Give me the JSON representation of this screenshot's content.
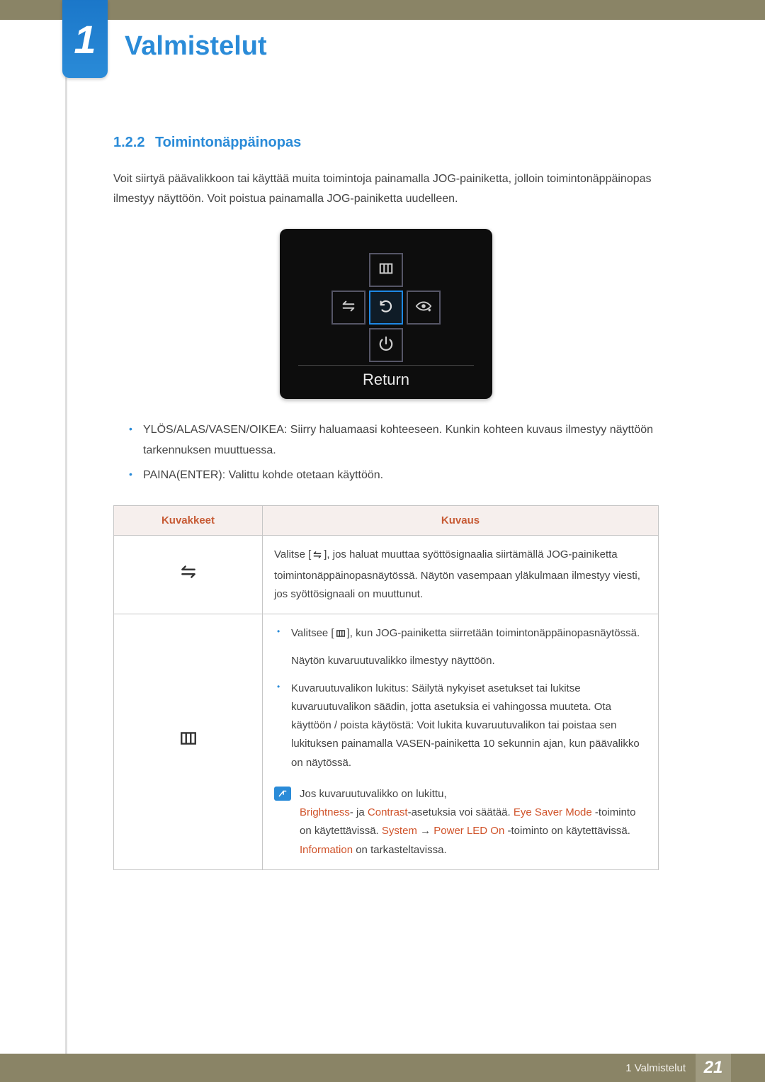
{
  "chapter": {
    "number": "1",
    "title": "Valmistelut"
  },
  "section": {
    "number": "1.2.2",
    "title": "Toimintonäppäinopas"
  },
  "intro": "Voit siirtyä päävalikkoon tai käyttää muita toimintoja painamalla JOG-painiketta, jolloin toimintonäppäinopas ilmestyy näyttöön. Voit poistua painamalla JOG-painiketta uudelleen.",
  "osd_label": "Return",
  "bullets": [
    "YLÖS/ALAS/VASEN/OIKEA: Siirry haluamaasi kohteeseen. Kunkin kohteen kuvaus ilmestyy näyttöön tarkennuksen muuttuessa.",
    "PAINA(ENTER): Valittu kohde otetaan käyttöön."
  ],
  "table": {
    "headers": {
      "icons": "Kuvakkeet",
      "desc": "Kuvaus"
    },
    "row1": {
      "before": "Valitse [",
      "after": "], jos haluat muuttaa syöttösignaalia siirtämällä JOG-painiketta toimintonäppäinopasnäytössä. Näytön vasempaan yläkulmaan ilmestyy viesti, jos syöttösignaali on muuttunut."
    },
    "row2": {
      "b1_before": "Valitsee [",
      "b1_after": "], kun JOG-painiketta siirretään toimintonäppäinopasnäytössä.",
      "b1_line2": "Näytön kuvaruutuvalikko ilmestyy näyttöön.",
      "b2": "Kuvaruutuvalikon lukitus: Säilytä nykyiset asetukset tai lukitse kuvaruutuvalikon säädin, jotta asetuksia ei vahingossa muuteta. Ota käyttöön / poista käytöstä: Voit lukita kuvaruutuvalikon tai poistaa sen lukituksen painamalla VASEN-painiketta 10 sekunnin ajan, kun päävalikko on näytössä.",
      "note_l1": "Jos kuvaruutuvalikko on lukittu,",
      "note_l2": {
        "s1": "Brightness",
        "t1": "- ja ",
        "s2": "Contrast",
        "t2": "-asetuksia voi säätää. ",
        "s3": "Eye Saver Mode",
        "t3": " -toiminto on käytettävissä. ",
        "s4": "System",
        "arrow": " → ",
        "s5": "Power LED On",
        "t4": " -toiminto on käytettävissä. ",
        "s6": "Information",
        "t5": " on tarkasteltavissa."
      }
    }
  },
  "footer": {
    "label": "1 Valmistelut",
    "page": "21"
  }
}
